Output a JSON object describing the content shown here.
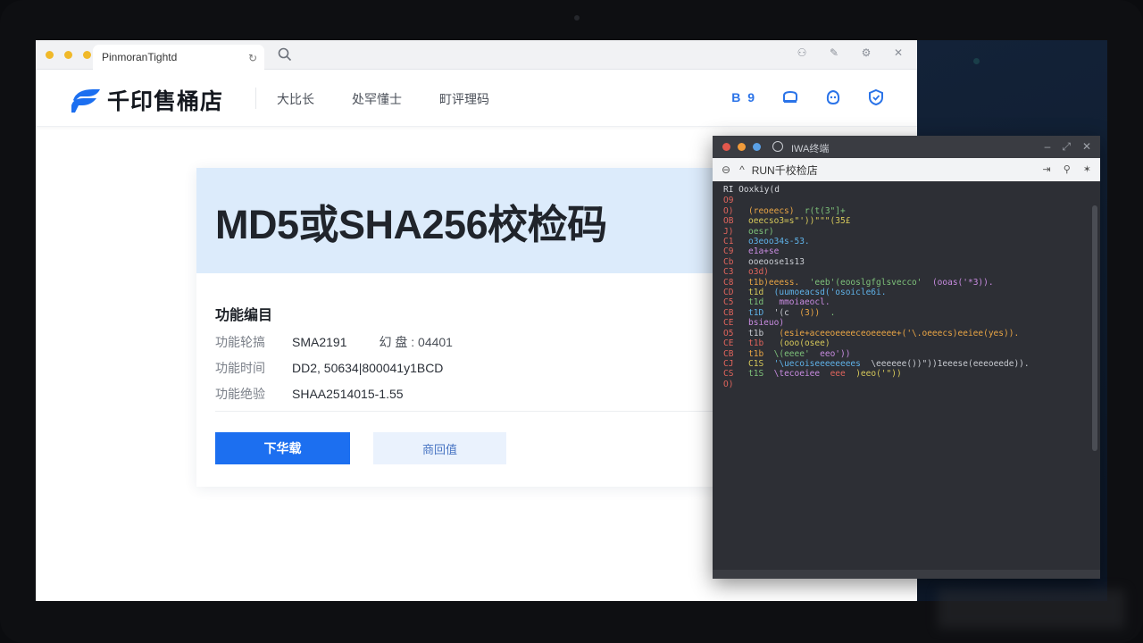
{
  "browser": {
    "tab_title": "PinmoranTightd",
    "tab_refresh_icon": "refresh-icon",
    "search_icon": "search-icon",
    "window_icons": [
      "user-icon",
      "edit-icon",
      "settings-icon",
      "close-icon"
    ],
    "traffic_color": "#f0b92a"
  },
  "site": {
    "logo_text": "千印售桶店",
    "nav": [
      "大比长",
      "处罕懂士",
      "町评理码"
    ],
    "nav_badge": "B 9",
    "nav_icons": [
      "chat-icon",
      "headset-icon",
      "support-icon",
      "shield-icon"
    ],
    "accent": "#1c6ff0"
  },
  "card": {
    "title": "MD5或SHA256校检码",
    "section_title": "功能编目",
    "rows": [
      {
        "label": "功能轮搞",
        "value": "SMA2191",
        "extra": "幻 盘 : 04401"
      },
      {
        "label": "功能时间",
        "value": "DD2, 50634|800041y1BCD",
        "extra": ""
      },
      {
        "label": "功能绝验",
        "value": "SHAA2514015-1.55",
        "extra": ""
      }
    ],
    "primary_button": "下华载",
    "secondary_button": "商回值"
  },
  "terminal": {
    "title": "IWA终端",
    "tab_label": "RUN千校检店",
    "prompt": "RI Ooxkiy(d",
    "lines": [
      {
        "num": "O9",
        "code": ""
      },
      {
        "num": "O)",
        "code": "(reoeecs)  r(t(3\"]+"
      },
      {
        "num": "OB",
        "code": "oeecso3=s\"'))\"\"\"(35£"
      },
      {
        "num": "J)",
        "code": "oesr)"
      },
      {
        "num": "C1",
        "code": "o3eoo34s-53."
      },
      {
        "num": "C9",
        "code": "e1a+se"
      },
      {
        "num": "Cb",
        "code": "ooeoose1s13"
      },
      {
        "num": "C3",
        "code": "o3d)"
      },
      {
        "num": "C8",
        "code": "t1b)eeess.  'eeb'(eooslgfglsvecco'  (ooas('*3))."
      },
      {
        "num": "CD",
        "code": "t1d  (uumoeacsd('osoicle6i."
      },
      {
        "num": "C5",
        "code": "t1d   mmoiaeocl."
      },
      {
        "num": "CB",
        "code": "t1D  '(c  (3))  ."
      },
      {
        "num": "CE",
        "code": "bsieuo)"
      },
      {
        "num": "O5",
        "code": "t1b   (esie+aceeoeeeeceoeeeee+('\\.oeeecs)eeiee(yes))."
      },
      {
        "num": "CE",
        "code": "t1b   (ooo(osee)"
      },
      {
        "num": "CB",
        "code": "t1b  \\(eeee'  eeo'))"
      },
      {
        "num": "CJ",
        "code": "C1S  '\\uecoiseeeeeeees  \\eeeeee())\"))1eeese(eeeoeede))."
      },
      {
        "num": "CS",
        "code": "t1S  \\tecoeiee  eee  )eeo('\"))"
      },
      {
        "num": "O)",
        "code": ""
      }
    ]
  }
}
